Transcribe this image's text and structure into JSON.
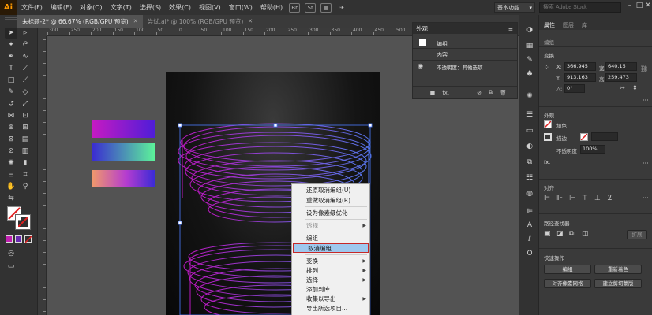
{
  "app": {
    "logo": "Ai"
  },
  "menu": [
    "文件(F)",
    "编辑(E)",
    "对象(O)",
    "文字(T)",
    "选择(S)",
    "效果(C)",
    "视图(V)",
    "窗口(W)",
    "帮助(H)"
  ],
  "menu_icons": [
    "Br",
    "St"
  ],
  "workspace": {
    "label": "基本功能"
  },
  "search": {
    "placeholder": "搜索 Adobe Stock"
  },
  "tabs": [
    {
      "label": "未标题-2* @ 66.67% (RGB/GPU 预览)",
      "active": true
    },
    {
      "label": "尝试.ai* @ 100% (RGB/GPU 预览)",
      "active": false
    }
  ],
  "ruler": {
    "ticks": [
      "300",
      "250",
      "200",
      "150",
      "100",
      "50",
      "0",
      "50",
      "100",
      "150",
      "200",
      "250",
      "300",
      "350",
      "400",
      "450",
      "500",
      "550",
      "600",
      "650",
      "700",
      "750"
    ]
  },
  "colors": {
    "bar1_start": "#c71ac2",
    "bar1_end": "#4f1dd8",
    "bar2_start": "#3a2ad2",
    "bar2_end": "#5cf29a",
    "bar3_start": "#f09a6a",
    "bar3_mid": "#b53cd0",
    "bar3_end": "#3b2bd6",
    "art_stroke_a": "#c21ac9",
    "art_stroke_b": "#5a7af5",
    "fill_swatch": "#c020b0",
    "stroke_swatch": "#6a2ab0"
  },
  "context_menu": {
    "items": [
      {
        "label": "还原取消编组(U)",
        "disabled": false,
        "submenu": false
      },
      {
        "label": "重做取消编组(R)",
        "disabled": false,
        "submenu": false
      },
      {
        "label": "设为像素级优化",
        "disabled": false,
        "submenu": false
      },
      {
        "label": "透视",
        "disabled": true,
        "submenu": true
      },
      {
        "label": "编组",
        "disabled": false,
        "submenu": false
      },
      {
        "label": "取消编组",
        "disabled": false,
        "submenu": false,
        "highlighted": true
      },
      {
        "label": "变换",
        "disabled": false,
        "submenu": true
      },
      {
        "label": "排列",
        "disabled": false,
        "submenu": true
      },
      {
        "label": "选择",
        "disabled": false,
        "submenu": true
      },
      {
        "label": "添加到库",
        "disabled": false,
        "submenu": false
      },
      {
        "label": "收集以导出",
        "disabled": false,
        "submenu": true
      },
      {
        "label": "导出所选项目...",
        "disabled": false,
        "submenu": false
      }
    ]
  },
  "appearance": {
    "title": "外观",
    "group_label": "编组",
    "content_label": "内容",
    "opacity_label": "不透明度：其他选项"
  },
  "properties": {
    "tabs": [
      "属性",
      "图层",
      "库"
    ],
    "object_type": "编组",
    "transform_title": "变换",
    "x_label": "X:",
    "x_value": "366.945",
    "y_label": "Y:",
    "y_value": "913.163",
    "w_label": "宽:",
    "w_value": "640.15",
    "h_label": "高:",
    "h_value": "259.473",
    "angle_label": "△:",
    "angle_value": "0°",
    "appearance_title": "外观",
    "fill_label": "填色",
    "stroke_label": "描边",
    "opacity_label": "不透明度",
    "opacity_value": "100%",
    "fx": "fx.",
    "align_title": "对齐",
    "pathfinder_title": "路径查找器",
    "pathfinder_expand": "扩展",
    "quick_actions_title": "快速操作",
    "btn_ungroup": "编组",
    "btn_recolor": "重新着色",
    "btn_grid": "对齐像素网格",
    "btn_symbol": "建立剪切蒙版"
  }
}
